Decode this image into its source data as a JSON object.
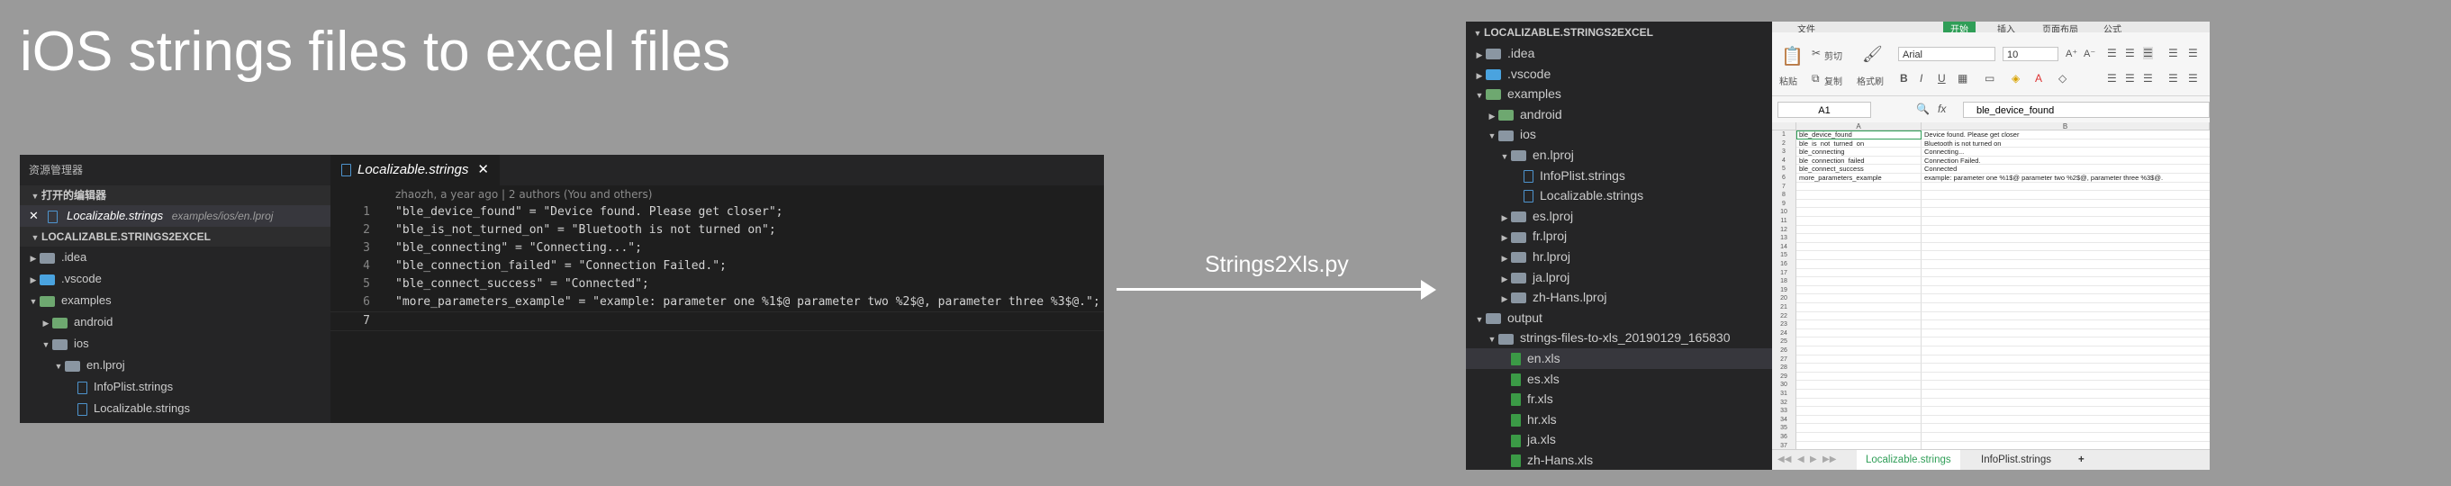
{
  "title": "iOS strings files to excel files",
  "arrow_label": "Strings2Xls.py",
  "vscode": {
    "sidebar_header": "资源管理器",
    "open_editors_label": "打开的编辑器",
    "open_file": {
      "close": "✕",
      "name": "Localizable.strings",
      "path": "examples/ios/en.lproj"
    },
    "project_label": "LOCALIZABLE.STRINGS2EXCEL",
    "tree": [
      {
        "label": ".idea",
        "twisty": "▶",
        "icon": "folder-icon",
        "depth": 0
      },
      {
        "label": ".vscode",
        "twisty": "▶",
        "icon": "vscode-folder-icon",
        "depth": 0
      },
      {
        "label": "examples",
        "twisty": "▼",
        "icon": "examples-folder-icon",
        "depth": 0
      },
      {
        "label": "android",
        "twisty": "▶",
        "icon": "android-folder-icon",
        "depth": 1
      },
      {
        "label": "ios",
        "twisty": "▼",
        "icon": "folder-icon",
        "depth": 1
      },
      {
        "label": "en.lproj",
        "twisty": "▼",
        "icon": "folder-icon",
        "depth": 2
      },
      {
        "label": "InfoPlist.strings",
        "twisty": "",
        "icon": "file-icon",
        "depth": 3
      },
      {
        "label": "Localizable.strings",
        "twisty": "",
        "icon": "file-icon",
        "depth": 3
      }
    ],
    "tab": {
      "label": "Localizable.strings",
      "close": "✕"
    },
    "blame": "zhaozh, a year ago | 2 authors (You and others)",
    "code_lines": [
      {
        "num": "1",
        "text": "\"ble_device_found\" = \"Device found. Please get closer\";"
      },
      {
        "num": "2",
        "text": "\"ble_is_not_turned_on\" = \"Bluetooth is not turned on\";"
      },
      {
        "num": "3",
        "text": "\"ble_connecting\" = \"Connecting...\";"
      },
      {
        "num": "4",
        "text": "\"ble_connection_failed\" = \"Connection Failed.\";"
      },
      {
        "num": "5",
        "text": "\"ble_connect_success\" = \"Connected\";"
      },
      {
        "num": "6",
        "text": "\"more_parameters_example\" = \"example: parameter one %1$@ parameter two %2$@, parameter three %3$@.\";"
      },
      {
        "num": "7",
        "text": ""
      }
    ]
  },
  "explorer": {
    "root": "LOCALIZABLE.STRINGS2EXCEL",
    "items": [
      {
        "label": ".idea",
        "twisty": "▶",
        "icon": "folder-icon",
        "depth": 0
      },
      {
        "label": ".vscode",
        "twisty": "▶",
        "icon": "vscode-folder-icon",
        "depth": 0
      },
      {
        "label": "examples",
        "twisty": "▼",
        "icon": "examples-folder-icon",
        "depth": 0
      },
      {
        "label": "android",
        "twisty": "▶",
        "icon": "android-folder-icon",
        "depth": 1
      },
      {
        "label": "ios",
        "twisty": "▼",
        "icon": "folder-icon",
        "depth": 1
      },
      {
        "label": "en.lproj",
        "twisty": "▼",
        "icon": "folder-icon",
        "depth": 2
      },
      {
        "label": "InfoPlist.strings",
        "twisty": "",
        "icon": "file-icon",
        "depth": 3
      },
      {
        "label": "Localizable.strings",
        "twisty": "",
        "icon": "file-icon",
        "depth": 3
      },
      {
        "label": "es.lproj",
        "twisty": "▶",
        "icon": "folder-icon",
        "depth": 2
      },
      {
        "label": "fr.lproj",
        "twisty": "▶",
        "icon": "folder-icon",
        "depth": 2
      },
      {
        "label": "hr.lproj",
        "twisty": "▶",
        "icon": "folder-icon",
        "depth": 2
      },
      {
        "label": "ja.lproj",
        "twisty": "▶",
        "icon": "folder-icon",
        "depth": 2
      },
      {
        "label": "zh-Hans.lproj",
        "twisty": "▶",
        "icon": "folder-icon",
        "depth": 2
      },
      {
        "label": "output",
        "twisty": "▼",
        "icon": "folder-icon",
        "depth": 0
      },
      {
        "label": "strings-files-to-xls_20190129_165830",
        "twisty": "▼",
        "icon": "folder-icon",
        "depth": 1
      },
      {
        "label": "en.xls",
        "twisty": "",
        "icon": "xls-file-icon",
        "depth": 2,
        "selected": true
      },
      {
        "label": "es.xls",
        "twisty": "",
        "icon": "xls-file-icon",
        "depth": 2
      },
      {
        "label": "fr.xls",
        "twisty": "",
        "icon": "xls-file-icon",
        "depth": 2
      },
      {
        "label": "hr.xls",
        "twisty": "",
        "icon": "xls-file-icon",
        "depth": 2
      },
      {
        "label": "ja.xls",
        "twisty": "",
        "icon": "xls-file-icon",
        "depth": 2
      },
      {
        "label": "zh-Hans.xls",
        "twisty": "",
        "icon": "xls-file-icon",
        "depth": 2
      }
    ]
  },
  "excel": {
    "menu": {
      "file": "文件",
      "start": "开始",
      "insert": "插入",
      "layout": "页面布局",
      "formula": "公式"
    },
    "ribbon": {
      "paste": "粘贴",
      "cut": "剪切",
      "copy": "复制",
      "format_painter": "格式刷",
      "font": "Arial",
      "size": "10"
    },
    "name_box": "A1",
    "fx": "fx",
    "formula_value": "ble_device_found",
    "col_headers": [
      "A",
      "B"
    ],
    "rows": [
      {
        "n": "1",
        "a": "ble_device_found",
        "b": "Device found. Please get closer"
      },
      {
        "n": "2",
        "a": "ble_is_not_turned_on",
        "b": "Bluetooth is not turned on"
      },
      {
        "n": "3",
        "a": "ble_connecting",
        "b": "Connecting..."
      },
      {
        "n": "4",
        "a": "ble_connection_failed",
        "b": "Connection Failed."
      },
      {
        "n": "5",
        "a": "ble_connect_success",
        "b": "Connected"
      },
      {
        "n": "6",
        "a": "more_parameters_example",
        "b": "example: parameter one %1$@ parameter two %2$@, parameter three %3$@."
      },
      {
        "n": "7",
        "a": "",
        "b": ""
      },
      {
        "n": "8",
        "a": "",
        "b": ""
      },
      {
        "n": "9",
        "a": "",
        "b": ""
      },
      {
        "n": "10",
        "a": "",
        "b": ""
      },
      {
        "n": "11",
        "a": "",
        "b": ""
      },
      {
        "n": "12",
        "a": "",
        "b": ""
      },
      {
        "n": "13",
        "a": "",
        "b": ""
      },
      {
        "n": "14",
        "a": "",
        "b": ""
      },
      {
        "n": "15",
        "a": "",
        "b": ""
      },
      {
        "n": "16",
        "a": "",
        "b": ""
      },
      {
        "n": "17",
        "a": "",
        "b": ""
      },
      {
        "n": "18",
        "a": "",
        "b": ""
      },
      {
        "n": "19",
        "a": "",
        "b": ""
      },
      {
        "n": "20",
        "a": "",
        "b": ""
      },
      {
        "n": "21",
        "a": "",
        "b": ""
      },
      {
        "n": "22",
        "a": "",
        "b": ""
      },
      {
        "n": "23",
        "a": "",
        "b": ""
      },
      {
        "n": "24",
        "a": "",
        "b": ""
      },
      {
        "n": "25",
        "a": "",
        "b": ""
      },
      {
        "n": "26",
        "a": "",
        "b": ""
      },
      {
        "n": "27",
        "a": "",
        "b": ""
      },
      {
        "n": "28",
        "a": "",
        "b": ""
      },
      {
        "n": "29",
        "a": "",
        "b": ""
      },
      {
        "n": "30",
        "a": "",
        "b": ""
      },
      {
        "n": "31",
        "a": "",
        "b": ""
      },
      {
        "n": "32",
        "a": "",
        "b": ""
      },
      {
        "n": "33",
        "a": "",
        "b": ""
      },
      {
        "n": "34",
        "a": "",
        "b": ""
      },
      {
        "n": "35",
        "a": "",
        "b": ""
      },
      {
        "n": "36",
        "a": "",
        "b": ""
      },
      {
        "n": "37",
        "a": "",
        "b": ""
      }
    ],
    "sheets": [
      {
        "label": "Localizable.strings",
        "active": true
      },
      {
        "label": "InfoPlist.strings",
        "active": false
      }
    ],
    "add_sheet": "+",
    "accent_color": "#2f9e57"
  }
}
